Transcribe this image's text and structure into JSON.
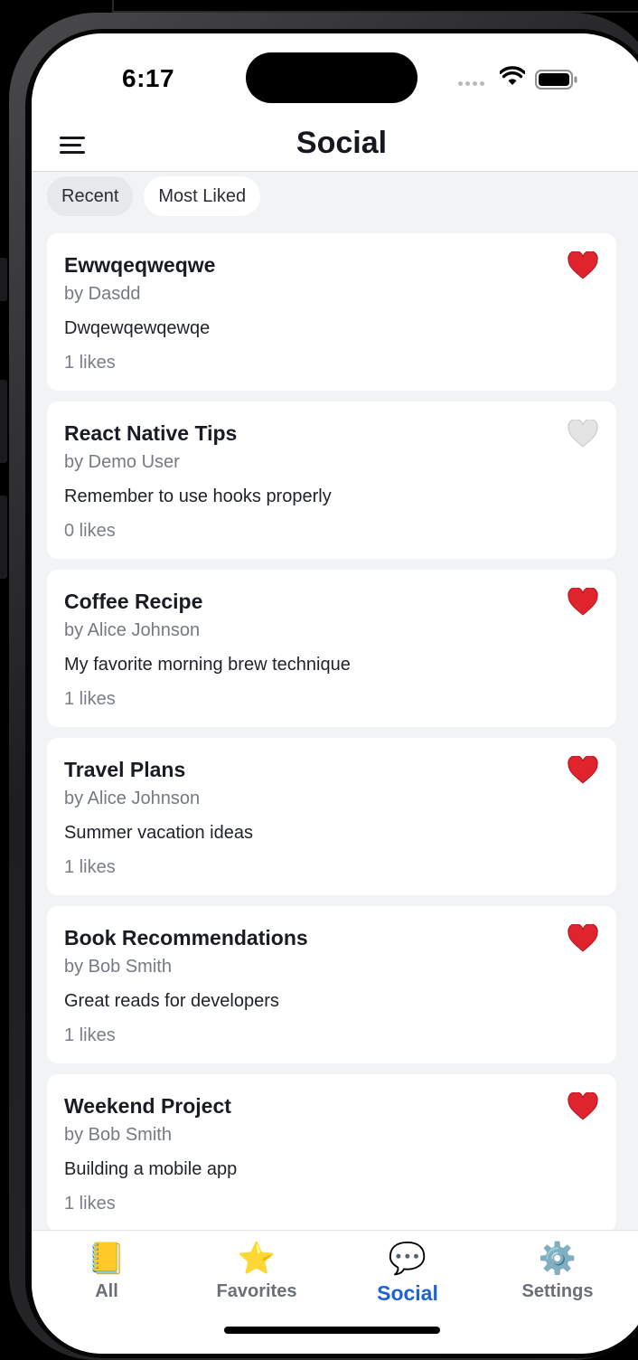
{
  "status_bar": {
    "time": "6:17",
    "icons": [
      "cellular-signal-icon",
      "wifi-icon",
      "battery-icon"
    ]
  },
  "header": {
    "title": "Social",
    "menu_icon": "hamburger-menu-icon"
  },
  "filters": [
    {
      "label": "Recent",
      "selected": false
    },
    {
      "label": "Most Liked",
      "selected": true
    }
  ],
  "posts": [
    {
      "title": "Ewwqeqweqwe",
      "author": "by Dasdd",
      "body": "Dwqewqewqewqe",
      "likes": "1 likes",
      "liked": true
    },
    {
      "title": "React Native Tips",
      "author": "by Demo User",
      "body": "Remember to use hooks properly",
      "likes": "0 likes",
      "liked": false
    },
    {
      "title": "Coffee Recipe",
      "author": "by Alice Johnson",
      "body": "My favorite morning brew technique",
      "likes": "1 likes",
      "liked": true
    },
    {
      "title": "Travel Plans",
      "author": "by Alice Johnson",
      "body": "Summer vacation ideas",
      "likes": "1 likes",
      "liked": true
    },
    {
      "title": "Book Recommendations",
      "author": "by Bob Smith",
      "body": "Great reads for developers",
      "likes": "1 likes",
      "liked": true
    },
    {
      "title": "Weekend Project",
      "author": "by Bob Smith",
      "body": "Building a mobile app",
      "likes": "1 likes",
      "liked": true
    }
  ],
  "tabs": [
    {
      "label": "All",
      "icon": "notebook-icon",
      "glyph": "📒",
      "active": false
    },
    {
      "label": "Favorites",
      "icon": "star-icon",
      "glyph": "⭐",
      "active": false
    },
    {
      "label": "Social",
      "icon": "speech-bubble-icon",
      "glyph": "💬",
      "active": true
    },
    {
      "label": "Settings",
      "icon": "gear-icon",
      "glyph": "⚙️",
      "active": false
    }
  ],
  "colors": {
    "accent": "#1e63d6",
    "heart_liked": "#e0242e",
    "heart_unliked": "#d9d9d9",
    "background": "#f2f3f5"
  }
}
